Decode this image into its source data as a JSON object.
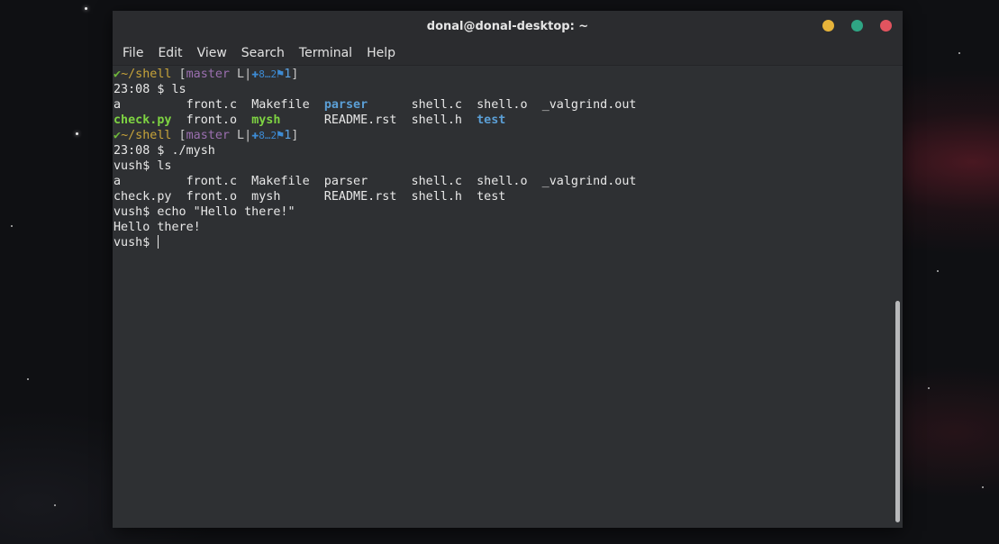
{
  "window": {
    "title": "donal@donal-desktop: ~"
  },
  "menu": {
    "file": "File",
    "edit": "Edit",
    "view": "View",
    "search": "Search",
    "terminal": "Terminal",
    "help": "Help"
  },
  "terminal": {
    "prompt1": {
      "check": "✔",
      "cwd": "~/shell",
      "open": " [",
      "branch": "master",
      "upstream": " L|",
      "plus": "✚",
      "ahead": "8…2",
      "flag": "⚑",
      "flagcount": "1",
      "close": "]"
    },
    "cmd1": "23:08 $ ls",
    "ls1": {
      "row1": {
        "a": "a         ",
        "front_c": "front.c  ",
        "makefile": "Makefile  ",
        "parser": "parser",
        "pad_parser": "      ",
        "shell_c": "shell.c  ",
        "shell_o": "shell.o  ",
        "valgrind": "_valgrind.out"
      },
      "row2": {
        "check_py": "check.py",
        "sp1": "  ",
        "front_o": "front.o  ",
        "mysh": "mysh",
        "sp2": "      ",
        "readme": "README.rst  ",
        "shell_h": "shell.h  ",
        "test": "test"
      }
    },
    "prompt2": {
      "check": "✔",
      "cwd": "~/shell",
      "open": " [",
      "branch": "master",
      "upstream": " L|",
      "plus": "✚",
      "ahead": "8…2",
      "flag": "⚑",
      "flagcount": "1",
      "close": "]"
    },
    "cmd2": "23:08 $ ./mysh",
    "cmd3": "vush$ ls",
    "ls2_row1": "a         front.c  Makefile  parser      shell.c  shell.o  _valgrind.out",
    "ls2_row2": "check.py  front.o  mysh      README.rst  shell.h  test",
    "cmd4": "vush$ echo \"Hello there!\"",
    "output": "Hello there!",
    "prompt_current": "vush$ "
  },
  "colors": {
    "check": "#70b83a",
    "cwd": "#c8a43a",
    "branch": "#9b6fb0",
    "directory": "#5b9fd6",
    "executable": "#7ed342",
    "minimize": "#e6b33a",
    "maximize": "#2fa584",
    "close": "#e2545f"
  }
}
